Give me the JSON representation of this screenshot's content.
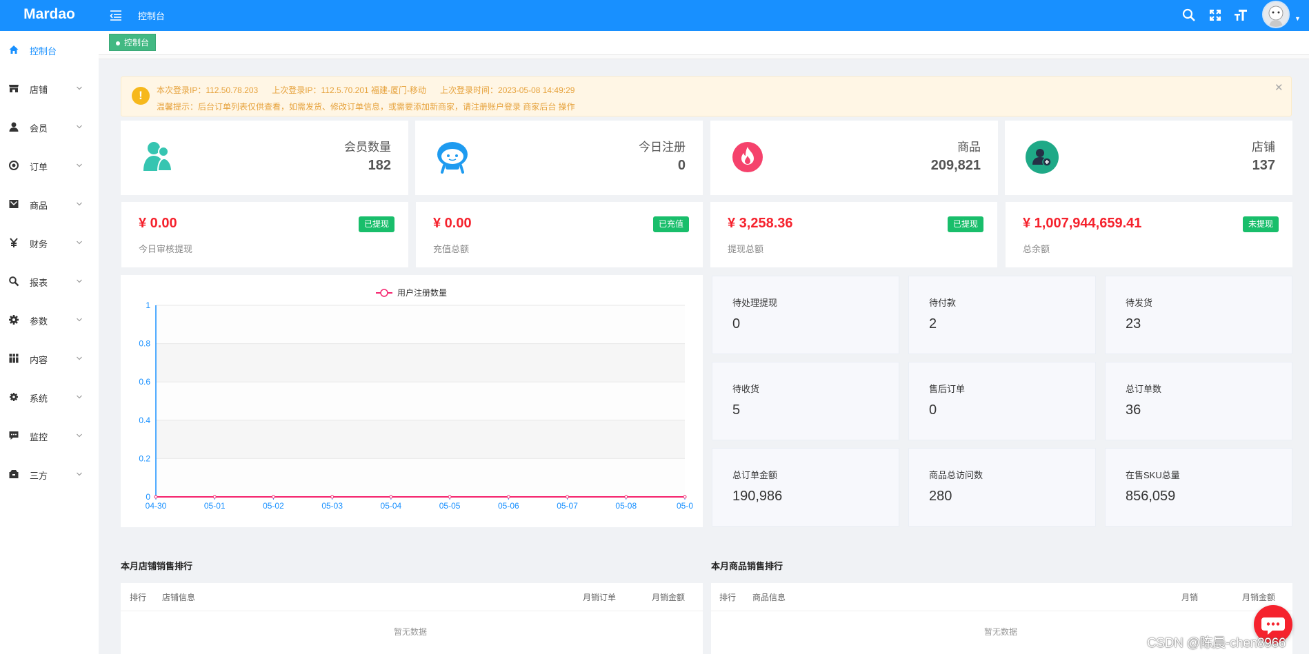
{
  "app": {
    "name": "Mardao"
  },
  "header": {
    "title": "控制台"
  },
  "sidebar": {
    "items": [
      {
        "label": "控制台",
        "icon": "home-icon"
      },
      {
        "label": "店铺",
        "icon": "shop-icon"
      },
      {
        "label": "会员",
        "icon": "user-icon"
      },
      {
        "label": "订单",
        "icon": "order-icon"
      },
      {
        "label": "商品",
        "icon": "goods-icon"
      },
      {
        "label": "财务",
        "icon": "yen-icon"
      },
      {
        "label": "报表",
        "icon": "search-icon"
      },
      {
        "label": "参数",
        "icon": "gear-icon"
      },
      {
        "label": "内容",
        "icon": "grid-icon"
      },
      {
        "label": "系统",
        "icon": "cog-icon"
      },
      {
        "label": "监控",
        "icon": "message-icon"
      },
      {
        "label": "三方",
        "icon": "briefcase-icon"
      }
    ]
  },
  "tabs": {
    "home": "控制台"
  },
  "alert": {
    "line1": "本次登录IP：112.50.78.203      上次登录IP：112.5.70.201 福建-厦门-移动      上次登录时间：2023-05-08 14:49:29",
    "line2": "温馨提示：后台订单列表仅供查看，如需发货、修改订单信息，或需要添加新商家，请注册账户登录 商家后台 操作"
  },
  "stats": [
    {
      "label": "会员数量",
      "value": "182"
    },
    {
      "label": "今日注册",
      "value": "0"
    },
    {
      "label": "商品",
      "value": "209,821"
    },
    {
      "label": "店铺",
      "value": "137"
    }
  ],
  "finance": [
    {
      "amount": "¥ 0.00",
      "label": "今日审核提现",
      "tag": "已提现"
    },
    {
      "amount": "¥ 0.00",
      "label": "充值总额",
      "tag": "已充值"
    },
    {
      "amount": "¥ 3,258.36",
      "label": "提现总额",
      "tag": "已提现"
    },
    {
      "amount": "¥ 1,007,944,659.41",
      "label": "总余额",
      "tag": "未提现"
    }
  ],
  "chart_data": {
    "type": "line",
    "x": [
      "04-30",
      "05-01",
      "05-02",
      "05-03",
      "05-04",
      "05-05",
      "05-06",
      "05-07",
      "05-08",
      "05-0"
    ],
    "series": [
      {
        "name": "用户注册数量",
        "values": [
          0,
          0,
          0,
          0,
          0,
          0,
          0,
          0,
          0,
          0
        ]
      }
    ],
    "yticks": [
      "0",
      "0.2",
      "0.4",
      "0.6",
      "0.8",
      "1"
    ],
    "ylim": [
      0,
      1
    ],
    "legend_position": "top-center",
    "color": "#f5226d"
  },
  "kpis": [
    {
      "label": "待处理提现",
      "value": "0"
    },
    {
      "label": "待付款",
      "value": "2"
    },
    {
      "label": "待发货",
      "value": "23"
    },
    {
      "label": "待收货",
      "value": "5"
    },
    {
      "label": "售后订单",
      "value": "0"
    },
    {
      "label": "总订单数",
      "value": "36"
    },
    {
      "label": "总订单金额",
      "value": "190,986"
    },
    {
      "label": "商品总访问数",
      "value": "280"
    },
    {
      "label": "在售SKU总量",
      "value": "856,059"
    }
  ],
  "shop_rank": {
    "title": "本月店铺销售排行",
    "columns": [
      "排行",
      "店铺信息",
      "月销订单",
      "月销金额"
    ],
    "empty": "暂无数据"
  },
  "goods_rank": {
    "title": "本月商品销售排行",
    "columns": [
      "排行",
      "商品信息",
      "月销",
      "月销金额"
    ],
    "empty": "暂无数据"
  },
  "watermark": "CSDN @陈晨-chen8966",
  "colors": {
    "primary": "#1890ff",
    "tag_green": "#19be6b",
    "amount_red": "#f5222d",
    "tab_green": "#42b983"
  }
}
